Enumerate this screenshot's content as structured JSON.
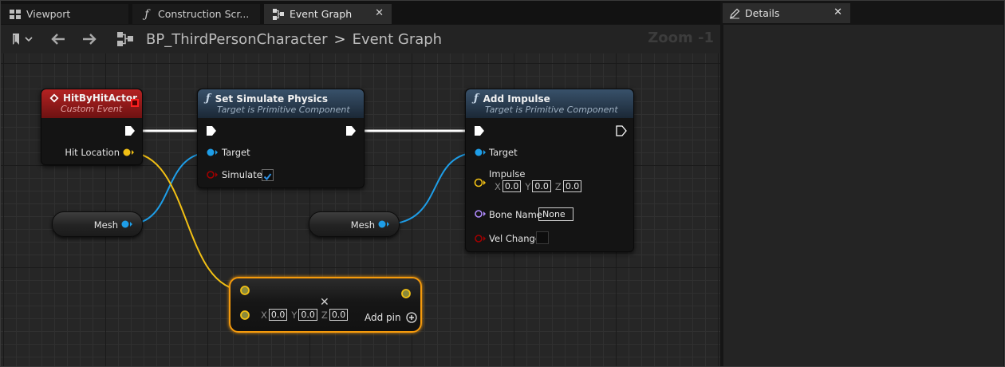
{
  "tabs": [
    {
      "label": "Viewport",
      "icon": "viewport-grid-icon"
    },
    {
      "label": "Construction Scr...",
      "icon": "function-icon"
    },
    {
      "label": "Event Graph",
      "icon": "graph-icon"
    }
  ],
  "details_tab": {
    "label": "Details",
    "icon": "pencil-icon"
  },
  "breadcrumb": {
    "blueprint": "BP_ThirdPersonCharacter",
    "separator": ">",
    "graph": "Event Graph"
  },
  "zoom": "Zoom -1",
  "nodes": {
    "hit_event": {
      "title": "HitByHitActor",
      "subtitle": "Custom Event",
      "pin_hit_location": "Hit Location"
    },
    "set_physics": {
      "title": "Set Simulate Physics",
      "subtitle": "Target is Primitive Component",
      "pin_target": "Target",
      "pin_simulate": "Simulate",
      "simulate_checked": true
    },
    "add_impulse": {
      "title": "Add Impulse",
      "subtitle": "Target is Primitive Component",
      "pin_target": "Target",
      "pin_impulse": "Impulse",
      "impulse": {
        "x_label": "X",
        "x": "0.0",
        "y_label": "Y",
        "y": "0.0",
        "z_label": "Z",
        "z": "0.0"
      },
      "pin_bone_name": "Bone Name",
      "bone_name": "None",
      "pin_vel_change": "Vel Change",
      "vel_change_checked": false
    },
    "mesh_1": {
      "label": "Mesh"
    },
    "mesh_2": {
      "label": "Mesh"
    },
    "add_vector": {
      "x_label": "X",
      "x": "0.0",
      "y_label": "Y",
      "y": "0.0",
      "z_label": "Z",
      "z": "0.0",
      "add_pin": "Add pin",
      "operator": "✕"
    }
  },
  "colors": {
    "exec_wire": "#ffffff",
    "object_pin": "#1e9ee8",
    "vector_pin": "#f2c014",
    "bool_pin": "#a00000",
    "name_pin": "#b18cff",
    "selection": "#f59a0c"
  }
}
